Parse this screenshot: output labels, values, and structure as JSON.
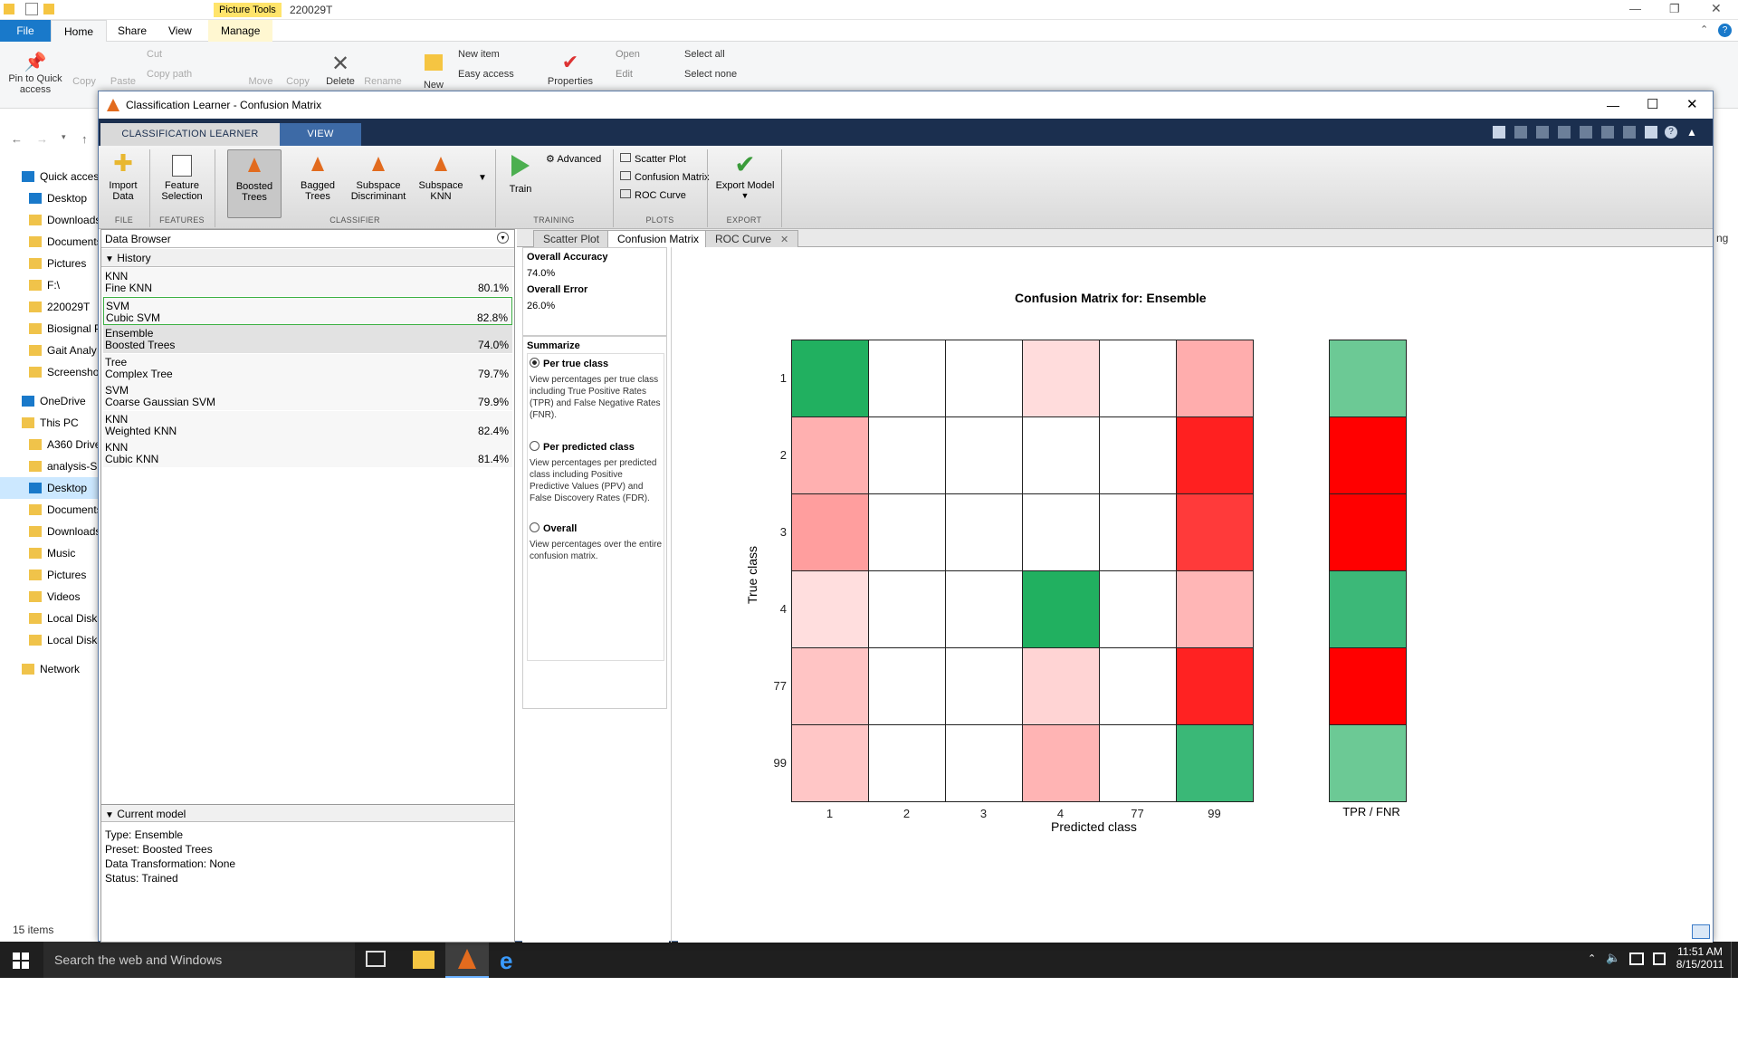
{
  "explorer": {
    "title": "220029T",
    "context_tab": "Picture Tools",
    "tabs": [
      "File",
      "Home",
      "Share",
      "View",
      "Manage"
    ],
    "ribbon": {
      "pin": "Pin to Quick access",
      "copy": "Copy",
      "paste": "Paste",
      "cut": "Cut",
      "copy_path": "Copy path",
      "move": "Move",
      "copy_to": "Copy",
      "delete": "Delete",
      "rename": "Rename",
      "new": "New",
      "new_item": "New item",
      "easy_access": "Easy access",
      "properties": "Properties",
      "open": "Open",
      "edit": "Edit",
      "select_all": "Select all",
      "select_none": "Select none"
    },
    "nav": [
      "Quick access",
      "Desktop",
      "Downloads",
      "Documents",
      "Pictures",
      "F:\\",
      "220029T",
      "Biosignal P",
      "Gait Analy",
      "Screenshots",
      "OneDrive",
      "This PC",
      "A360 Drive",
      "analysis-S",
      "Desktop",
      "Documents",
      "Downloads",
      "Music",
      "Pictures",
      "Videos",
      "Local Disk",
      "Local Disk",
      "Network"
    ],
    "status": "15 items",
    "right_cut": "ng"
  },
  "window": {
    "title": "Classification Learner - Confusion Matrix",
    "tabs": [
      "CLASSIFICATION LEARNER",
      "VIEW"
    ]
  },
  "toolstrip": {
    "import": "Import Data",
    "feature": "Feature Selection",
    "boosted": "Boosted Trees",
    "bagged": "Bagged Trees",
    "subdisc": "Subspace Discriminant",
    "subknn": "Subspace KNN",
    "train": "Train",
    "advanced": "Advanced",
    "scatter": "Scatter Plot",
    "confusion": "Confusion Matrix",
    "roc": "ROC Curve",
    "export": "Export Model",
    "sections": [
      "FILE",
      "FEATURES",
      "CLASSIFIER",
      "TRAINING",
      "PLOTS",
      "EXPORT"
    ]
  },
  "data_browser": {
    "title": "Data Browser",
    "history_label": "History",
    "history": [
      {
        "type": "KNN",
        "name": "Fine KNN",
        "acc": "80.1%"
      },
      {
        "type": "SVM",
        "name": "Cubic SVM",
        "acc": "82.8%"
      },
      {
        "type": "Ensemble",
        "name": "Boosted Trees",
        "acc": "74.0%"
      },
      {
        "type": "Tree",
        "name": "Complex Tree",
        "acc": "79.7%"
      },
      {
        "type": "SVM",
        "name": "Coarse Gaussian SVM",
        "acc": "79.9%"
      },
      {
        "type": "KNN",
        "name": "Weighted KNN",
        "acc": "82.4%"
      },
      {
        "type": "KNN",
        "name": "Cubic KNN",
        "acc": "81.4%"
      }
    ],
    "current_label": "Current model",
    "current": [
      "Type: Ensemble",
      "Preset: Boosted Trees",
      "Data Transformation: None",
      "Status: Trained"
    ]
  },
  "plot_tabs": [
    "Scatter Plot",
    "Confusion Matrix",
    "ROC Curve"
  ],
  "summary": {
    "acc_label": "Overall Accuracy",
    "acc": "74.0%",
    "err_label": "Overall Error",
    "err": "26.0%",
    "summarize": "Summarize",
    "opt1": "Per true class",
    "opt1_desc": "View percentages per true class including True Positive Rates (TPR) and False Negative Rates (FNR).",
    "opt2": "Per predicted class",
    "opt2_desc": "View percentages per predicted class including Positive Predictive Values (PPV) and False Discovery Rates (FDR).",
    "opt3": "Overall",
    "opt3_desc": "View percentages over the entire confusion matrix."
  },
  "chart_data": {
    "type": "heatmap",
    "title": "Confusion Matrix for: Ensemble",
    "xlabel": "Predicted class",
    "ylabel": "True class",
    "classes": [
      "1",
      "2",
      "3",
      "4",
      "77",
      "99"
    ],
    "colors": [
      [
        "#21b060",
        "#ffffff",
        "#ffffff",
        "#ffdcdc",
        "#ffffff",
        "#ffadad"
      ],
      [
        "#ffb0b0",
        "#ffffff",
        "#ffffff",
        "#ffffff",
        "#ffffff",
        "#ff2020"
      ],
      [
        "#ff9e9e",
        "#ffffff",
        "#ffffff",
        "#ffffff",
        "#ffffff",
        "#ff3a3a"
      ],
      [
        "#ffdede",
        "#ffffff",
        "#ffffff",
        "#21b060",
        "#ffffff",
        "#ffb6b6"
      ],
      [
        "#ffc4c4",
        "#ffffff",
        "#ffffff",
        "#ffd4d4",
        "#ffffff",
        "#ff2222"
      ],
      [
        "#ffc6c6",
        "#ffffff",
        "#ffffff",
        "#ffb4b4",
        "#ffffff",
        "#3ab877"
      ]
    ],
    "side_label": "TPR / FNR",
    "side_colors": [
      "#6cc995",
      "#ff0000",
      "#ff0000",
      "#3cb878",
      "#ff0000",
      "#6cc995"
    ]
  },
  "taskbar": {
    "search": "Search the web and Windows",
    "time": "11:51 AM",
    "date": "8/15/2011"
  }
}
